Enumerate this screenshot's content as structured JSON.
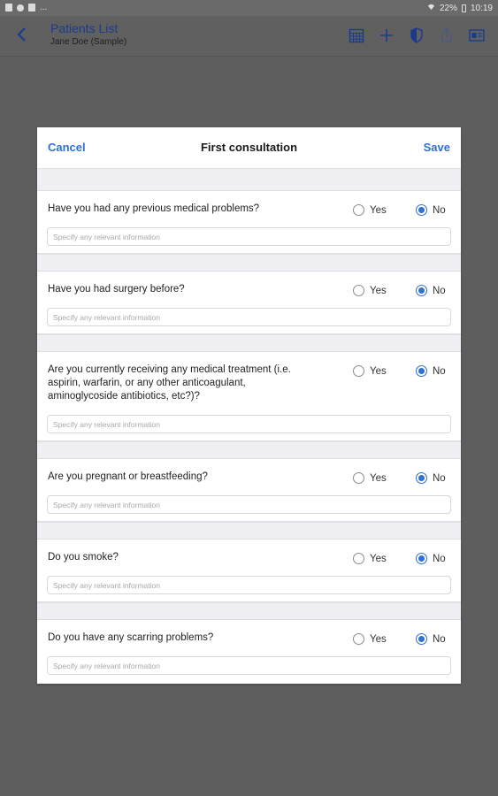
{
  "status_bar": {
    "battery_percent": "22%",
    "time": "10:19",
    "left_text": "..."
  },
  "app_bar": {
    "title": "Patients List",
    "subtitle": "Jane Doe (Sample)"
  },
  "modal": {
    "cancel_label": "Cancel",
    "title": "First consultation",
    "save_label": "Save",
    "yes_label": "Yes",
    "no_label": "No",
    "placeholder": "Specify any relevant information",
    "accent_color": "#2f6fd8",
    "questions": [
      {
        "text": "Have you had any previous medical problems?",
        "answer": "No"
      },
      {
        "text": "Have you had surgery before?",
        "answer": "No"
      },
      {
        "text": "Are you currently receiving any medical treatment (i.e. aspirin, warfarin, or any other anticoagulant, aminoglycoside antibiotics, etc?)?",
        "answer": "No"
      },
      {
        "text": "Are you pregnant or breastfeeding?",
        "answer": "No"
      },
      {
        "text": "Do you smoke?",
        "answer": "No"
      },
      {
        "text": "Do you have any scarring problems?",
        "answer": "No"
      }
    ]
  }
}
